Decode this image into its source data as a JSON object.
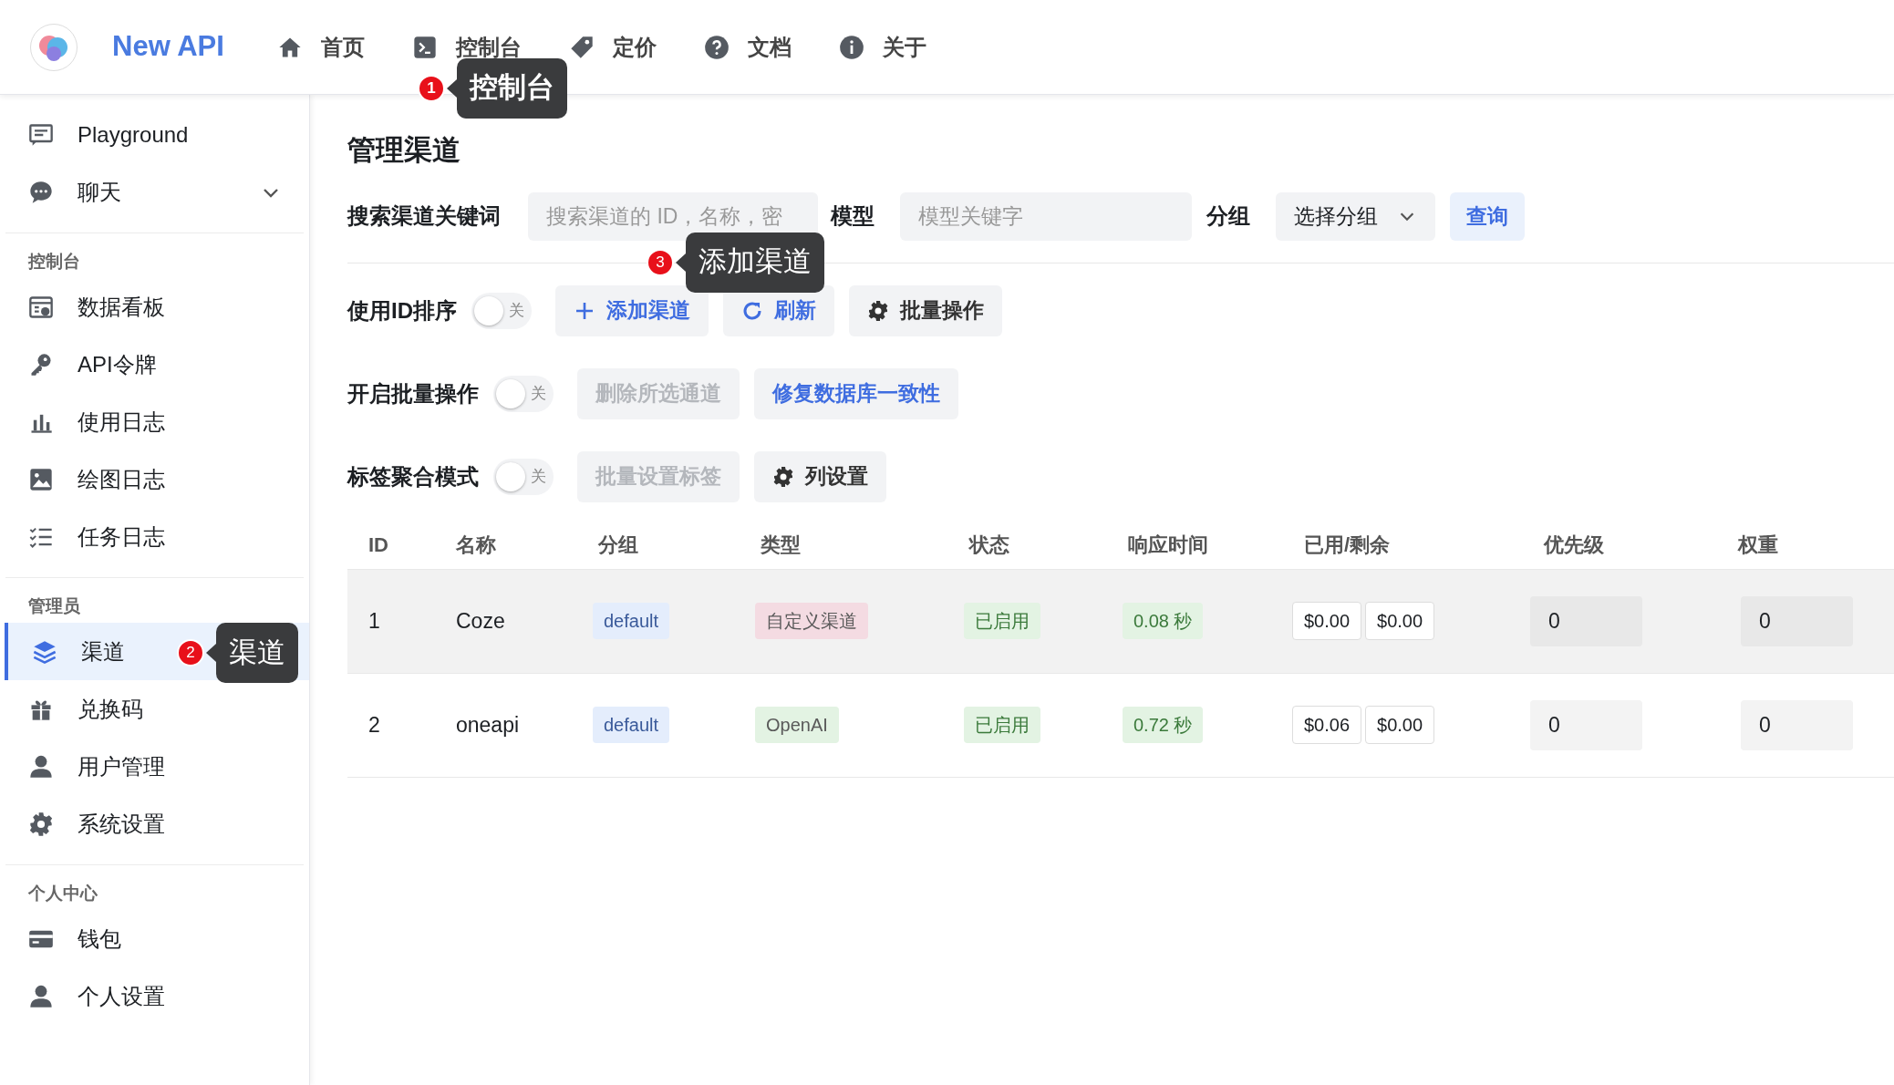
{
  "brand": {
    "name": "New API"
  },
  "nav": [
    {
      "label": "首页"
    },
    {
      "label": "控制台",
      "annotation": {
        "number": "1",
        "text": "控制台"
      }
    },
    {
      "label": "定价"
    },
    {
      "label": "文档"
    },
    {
      "label": "关于"
    }
  ],
  "sidebar": {
    "sections": [
      {
        "items": [
          {
            "label": "Playground",
            "selected": false
          },
          {
            "label": "聊天",
            "selected": false,
            "expandable": true
          }
        ]
      },
      {
        "title": "控制台",
        "items": [
          {
            "label": "数据看板",
            "selected": false
          },
          {
            "label": "API令牌",
            "selected": false
          },
          {
            "label": "使用日志",
            "selected": false
          },
          {
            "label": "绘图日志",
            "selected": false
          },
          {
            "label": "任务日志",
            "selected": false
          }
        ]
      },
      {
        "title": "管理员",
        "items": [
          {
            "label": "渠道",
            "selected": true,
            "annotation": {
              "number": "2",
              "text": "渠道"
            }
          },
          {
            "label": "兑换码",
            "selected": false
          },
          {
            "label": "用户管理",
            "selected": false
          },
          {
            "label": "系统设置",
            "selected": false
          }
        ]
      },
      {
        "title": "个人中心",
        "items": [
          {
            "label": "钱包",
            "selected": false
          },
          {
            "label": "个人设置",
            "selected": false
          }
        ]
      }
    ]
  },
  "page_title": "管理渠道",
  "search": {
    "keyword_label": "搜索渠道关键词",
    "keyword_placeholder": "搜索渠道的 ID，名称，密",
    "model_label": "模型",
    "model_placeholder": "模型关键字",
    "group_label": "分组",
    "group_select": "选择分组",
    "query_button": "查询"
  },
  "toolbar_rows": [
    {
      "label": "使用ID排序",
      "toggle": {
        "on": false,
        "text": "关"
      },
      "buttons": [
        {
          "label": "添加渠道",
          "kind": "primary",
          "disabled": false,
          "annotation": {
            "number": "3",
            "text": "添加渠道"
          }
        },
        {
          "label": "刷新",
          "kind": "primary",
          "disabled": false
        },
        {
          "label": "批量操作",
          "kind": "default",
          "disabled": false
        }
      ]
    },
    {
      "label": "开启批量操作",
      "toggle": {
        "on": false,
        "text": "关"
      },
      "buttons": [
        {
          "label": "删除所选通道",
          "kind": "default",
          "disabled": true
        },
        {
          "label": "修复数据库一致性",
          "kind": "primary",
          "disabled": false
        }
      ]
    },
    {
      "label": "标签聚合模式",
      "toggle": {
        "on": false,
        "text": "关"
      },
      "buttons": [
        {
          "label": "批量设置标签",
          "kind": "default",
          "disabled": true
        },
        {
          "label": "列设置",
          "kind": "default",
          "disabled": false
        }
      ]
    }
  ],
  "table": {
    "columns": [
      "ID",
      "名称",
      "分组",
      "类型",
      "状态",
      "响应时间",
      "已用/剩余",
      "优先级",
      "权重"
    ],
    "rows": [
      {
        "hovered": true,
        "id": "1",
        "name": "Coze",
        "group": "default",
        "type": {
          "text": "自定义渠道",
          "color": "#f4dbe2"
        },
        "status": "已启用",
        "response_time": "0.08 秒",
        "used": "$0.00",
        "remaining": "$0.00",
        "priority": "0",
        "weight": "0"
      },
      {
        "hovered": false,
        "id": "2",
        "name": "oneapi",
        "group": "default",
        "type": {
          "text": "OpenAI",
          "color": "#e3f3e3"
        },
        "status": "已启用",
        "response_time": "0.72 秒",
        "used": "$0.06",
        "remaining": "$0.00",
        "priority": "0",
        "weight": "0"
      }
    ]
  }
}
